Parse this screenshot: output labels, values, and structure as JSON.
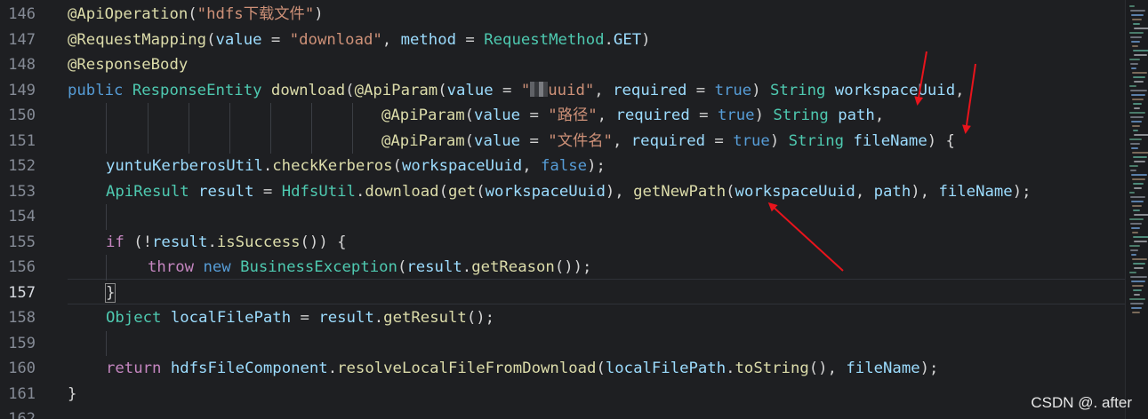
{
  "editor": {
    "line_numbers": [
      "146",
      "147",
      "148",
      "149",
      "150",
      "151",
      "152",
      "153",
      "154",
      "155",
      "156",
      "157",
      "158",
      "159",
      "160",
      "161",
      "162"
    ],
    "current_line": "157",
    "lines": [
      [
        {
          "c": "ann",
          "t": "@ApiOperation"
        },
        {
          "c": "txt",
          "t": "("
        },
        {
          "c": "str",
          "t": "\"hdfs下载文件\""
        },
        {
          "c": "txt",
          "t": ")"
        }
      ],
      [
        {
          "c": "ann",
          "t": "@RequestMapping"
        },
        {
          "c": "txt",
          "t": "("
        },
        {
          "c": "var",
          "t": "value"
        },
        {
          "c": "txt",
          "t": " = "
        },
        {
          "c": "str",
          "t": "\"download\""
        },
        {
          "c": "txt",
          "t": ", "
        },
        {
          "c": "var",
          "t": "method"
        },
        {
          "c": "txt",
          "t": " = "
        },
        {
          "c": "typ",
          "t": "RequestMethod"
        },
        {
          "c": "txt",
          "t": "."
        },
        {
          "c": "var",
          "t": "GET"
        },
        {
          "c": "txt",
          "t": ")"
        }
      ],
      [
        {
          "c": "ann",
          "t": "@ResponseBody"
        }
      ],
      [
        {
          "c": "kw",
          "t": "public"
        },
        {
          "c": "txt",
          "t": " "
        },
        {
          "c": "typ",
          "t": "ResponseEntity"
        },
        {
          "c": "txt",
          "t": " "
        },
        {
          "c": "fn",
          "t": "download"
        },
        {
          "c": "txt",
          "t": "("
        },
        {
          "c": "ann",
          "t": "@ApiParam"
        },
        {
          "c": "txt",
          "t": "("
        },
        {
          "c": "var",
          "t": "value"
        },
        {
          "c": "txt",
          "t": " = "
        },
        {
          "c": "str",
          "t": "\""
        },
        {
          "c": "blur",
          "t": ""
        },
        {
          "c": "str",
          "t": "uuid\""
        },
        {
          "c": "txt",
          "t": ", "
        },
        {
          "c": "var",
          "t": "required"
        },
        {
          "c": "txt",
          "t": " = "
        },
        {
          "c": "kw",
          "t": "true"
        },
        {
          "c": "txt",
          "t": ") "
        },
        {
          "c": "typ",
          "t": "String"
        },
        {
          "c": "txt",
          "t": " "
        },
        {
          "c": "var",
          "t": "workspaceUuid"
        },
        {
          "c": "txt",
          "t": ","
        }
      ],
      [
        {
          "c": "ann",
          "t": "@ApiParam"
        },
        {
          "c": "txt",
          "t": "("
        },
        {
          "c": "var",
          "t": "value"
        },
        {
          "c": "txt",
          "t": " = "
        },
        {
          "c": "str",
          "t": "\"路径\""
        },
        {
          "c": "txt",
          "t": ", "
        },
        {
          "c": "var",
          "t": "required"
        },
        {
          "c": "txt",
          "t": " = "
        },
        {
          "c": "kw",
          "t": "true"
        },
        {
          "c": "txt",
          "t": ") "
        },
        {
          "c": "typ",
          "t": "String"
        },
        {
          "c": "txt",
          "t": " "
        },
        {
          "c": "var",
          "t": "path"
        },
        {
          "c": "txt",
          "t": ","
        }
      ],
      [
        {
          "c": "ann",
          "t": "@ApiParam"
        },
        {
          "c": "txt",
          "t": "("
        },
        {
          "c": "var",
          "t": "value"
        },
        {
          "c": "txt",
          "t": " = "
        },
        {
          "c": "str",
          "t": "\"文件名\""
        },
        {
          "c": "txt",
          "t": ", "
        },
        {
          "c": "var",
          "t": "required"
        },
        {
          "c": "txt",
          "t": " = "
        },
        {
          "c": "kw",
          "t": "true"
        },
        {
          "c": "txt",
          "t": ") "
        },
        {
          "c": "typ",
          "t": "String"
        },
        {
          "c": "txt",
          "t": " "
        },
        {
          "c": "var",
          "t": "fileName"
        },
        {
          "c": "txt",
          "t": ") {"
        }
      ],
      [
        {
          "c": "var",
          "t": "yuntuKerberosUtil"
        },
        {
          "c": "txt",
          "t": "."
        },
        {
          "c": "fn",
          "t": "checkKerberos"
        },
        {
          "c": "txt",
          "t": "("
        },
        {
          "c": "var",
          "t": "workspaceUuid"
        },
        {
          "c": "txt",
          "t": ", "
        },
        {
          "c": "kw",
          "t": "false"
        },
        {
          "c": "txt",
          "t": ");"
        }
      ],
      [
        {
          "c": "typ",
          "t": "ApiResult"
        },
        {
          "c": "txt",
          "t": " "
        },
        {
          "c": "var",
          "t": "result"
        },
        {
          "c": "txt",
          "t": " = "
        },
        {
          "c": "typ",
          "t": "HdfsUtil"
        },
        {
          "c": "txt",
          "t": "."
        },
        {
          "c": "fn",
          "t": "download"
        },
        {
          "c": "txt",
          "t": "("
        },
        {
          "c": "fn",
          "t": "get"
        },
        {
          "c": "txt",
          "t": "("
        },
        {
          "c": "var",
          "t": "workspaceUuid"
        },
        {
          "c": "txt",
          "t": "), "
        },
        {
          "c": "fn",
          "t": "getNewPath"
        },
        {
          "c": "txt",
          "t": "("
        },
        {
          "c": "var",
          "t": "workspaceUuid"
        },
        {
          "c": "txt",
          "t": ", "
        },
        {
          "c": "var",
          "t": "path"
        },
        {
          "c": "txt",
          "t": "), "
        },
        {
          "c": "var",
          "t": "fileName"
        },
        {
          "c": "txt",
          "t": ");"
        }
      ],
      [],
      [
        {
          "c": "ctl",
          "t": "if"
        },
        {
          "c": "txt",
          "t": " (!"
        },
        {
          "c": "var",
          "t": "result"
        },
        {
          "c": "txt",
          "t": "."
        },
        {
          "c": "fn",
          "t": "isSuccess"
        },
        {
          "c": "txt",
          "t": "()) {"
        }
      ],
      [
        {
          "c": "ctl",
          "t": "throw"
        },
        {
          "c": "txt",
          "t": " "
        },
        {
          "c": "kw",
          "t": "new"
        },
        {
          "c": "txt",
          "t": " "
        },
        {
          "c": "typ",
          "t": "BusinessException"
        },
        {
          "c": "txt",
          "t": "("
        },
        {
          "c": "var",
          "t": "result"
        },
        {
          "c": "txt",
          "t": "."
        },
        {
          "c": "fn",
          "t": "getReason"
        },
        {
          "c": "txt",
          "t": "());"
        }
      ],
      [
        {
          "c": "brace",
          "t": "}"
        }
      ],
      [
        {
          "c": "typ",
          "t": "Object"
        },
        {
          "c": "txt",
          "t": " "
        },
        {
          "c": "var",
          "t": "localFilePath"
        },
        {
          "c": "txt",
          "t": " = "
        },
        {
          "c": "var",
          "t": "result"
        },
        {
          "c": "txt",
          "t": "."
        },
        {
          "c": "fn",
          "t": "getResult"
        },
        {
          "c": "txt",
          "t": "();"
        }
      ],
      [],
      [
        {
          "c": "ctl",
          "t": "return"
        },
        {
          "c": "txt",
          "t": " "
        },
        {
          "c": "var",
          "t": "hdfsFileComponent"
        },
        {
          "c": "txt",
          "t": "."
        },
        {
          "c": "fn",
          "t": "resolveLocalFileFromDownload"
        },
        {
          "c": "txt",
          "t": "("
        },
        {
          "c": "var",
          "t": "localFilePath"
        },
        {
          "c": "txt",
          "t": "."
        },
        {
          "c": "fn",
          "t": "toString"
        },
        {
          "c": "txt",
          "t": "(), "
        },
        {
          "c": "var",
          "t": "fileName"
        },
        {
          "c": "txt",
          "t": ");"
        }
      ],
      [
        {
          "c": "txt",
          "t": "}"
        }
      ],
      []
    ]
  },
  "watermark": "CSDN @. after",
  "colors": {
    "background": "#1e1f22",
    "annotation": "#dcdcaa",
    "string": "#ce9178",
    "keyword": "#569cd6",
    "type": "#4ec9b0",
    "variable": "#9cdcfe",
    "arrow": "#e8141c"
  }
}
